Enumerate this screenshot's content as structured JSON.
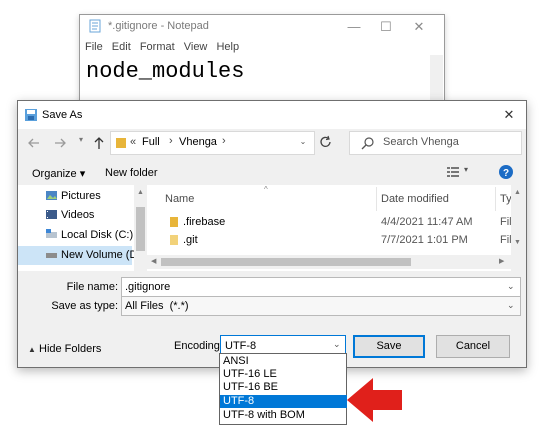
{
  "notepad": {
    "title": "*.gitignore - Notepad",
    "menu": [
      "File",
      "Edit",
      "Format",
      "View",
      "Help"
    ],
    "content": "node_modules"
  },
  "saveas": {
    "title": "Save As",
    "breadcrumb": {
      "prefix": "«",
      "parts": [
        "Full",
        "Vhenga"
      ]
    },
    "search_placeholder": "Search Vhenga",
    "toolbar": {
      "organize": "Organize ▾",
      "new_folder": "New folder"
    },
    "nav_items": [
      "Pictures",
      "Videos",
      "Local Disk (C:)",
      "New Volume (D:"
    ],
    "columns": {
      "name": "Name",
      "date": "Date modified",
      "type": "Ty"
    },
    "files": [
      {
        "name": ".firebase",
        "date": "4/4/2021 11:47 AM",
        "type": "Fil"
      },
      {
        "name": ".git",
        "date": "7/7/2021 1:01 PM",
        "type": "Fil"
      }
    ],
    "file_name_label": "File name:",
    "file_name_value": ".gitignore",
    "save_type_label": "Save as type:",
    "save_type_value": "All Files  (*.*)",
    "hide_folders": "Hide Folders",
    "encoding_label": "Encoding:",
    "encoding_value": "UTF-8",
    "save_button": "Save",
    "cancel_button": "Cancel",
    "encoding_options": [
      "ANSI",
      "UTF-16 LE",
      "UTF-16 BE",
      "UTF-8",
      "UTF-8 with BOM"
    ],
    "selected_encoding": "UTF-8"
  },
  "colors": {
    "accent": "#0078d7",
    "arrow": "#e0201b",
    "folder": "#e8b53a"
  },
  "icons": [
    "notepad-icon",
    "save-icon",
    "back-arrow-icon",
    "forward-arrow-icon",
    "up-arrow-icon",
    "refresh-icon",
    "search-icon",
    "view-icon",
    "help-icon",
    "folder-icon",
    "red-arrow-icon"
  ]
}
